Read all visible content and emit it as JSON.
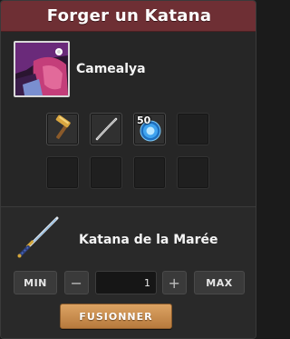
{
  "header": {
    "title": "Forger un Katana"
  },
  "character": {
    "name": "Camealya",
    "avatar_icon": "character-portrait-icon"
  },
  "ingredients": {
    "row1": [
      {
        "icon": "hammer-icon",
        "quantity": ""
      },
      {
        "icon": "katana-blade-icon",
        "quantity": ""
      },
      {
        "icon": "blue-orb-icon",
        "quantity": "50"
      },
      {
        "icon": "",
        "quantity": ""
      }
    ],
    "row2": [
      {
        "icon": "",
        "quantity": ""
      },
      {
        "icon": "",
        "quantity": ""
      },
      {
        "icon": "",
        "quantity": ""
      },
      {
        "icon": "",
        "quantity": ""
      }
    ]
  },
  "result": {
    "name": "Katana de la Marée",
    "icon": "katana-icon"
  },
  "controls": {
    "min_label": "MIN",
    "minus_label": "−",
    "quantity_value": "1",
    "plus_label": "+",
    "max_label": "MAX",
    "fuse_label": "FUSIONNER"
  },
  "colors": {
    "header": "#6e2f34",
    "panel": "#262626",
    "fuse_button": "#c98c4e"
  }
}
